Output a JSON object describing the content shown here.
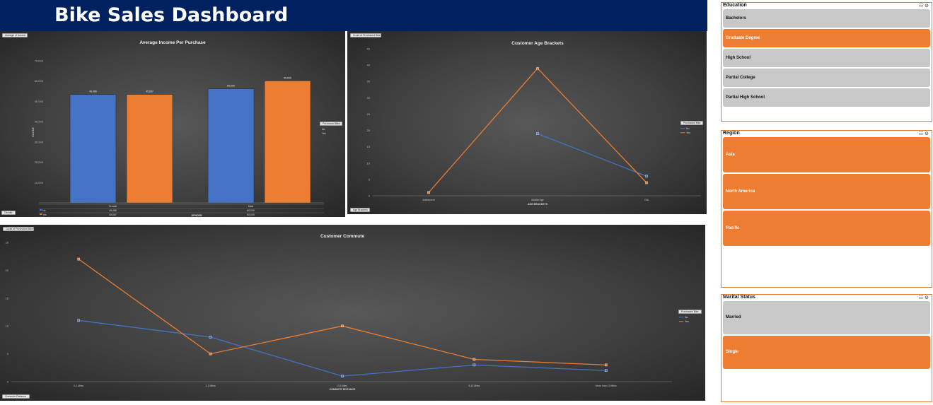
{
  "title": "Bike Sales Dashboard",
  "colors": {
    "no": "#4472c4",
    "yes": "#ed7d31",
    "banner": "#002060"
  },
  "chart1": {
    "filter_pill": "Average of Income",
    "axis_pill": "Gender",
    "legend_pill": "Purchased Bike",
    "legend_items": [
      "No",
      "Yes"
    ],
    "ytitle": "INCOME",
    "table_no_label": "No",
    "table_yes_label": "Yes"
  },
  "chart2": {
    "filter_pill": "Count of Purchased Bike",
    "axis_pill": "Age Brackets",
    "legend_pill": "Purchased Bike",
    "legend_items": [
      "No",
      "Yes"
    ]
  },
  "chart3": {
    "filter_pill": "Count of Purchased Bike",
    "axis_pill": "Commute Distance",
    "legend_pill": "Purchased Bike",
    "legend_items": [
      "No",
      "Yes"
    ],
    "ytitle": "AXIS TITLE"
  },
  "chart_data": [
    {
      "type": "bar",
      "title": "Average Income Per Purchase",
      "xlabel": "GENDER",
      "ylabel": "INCOME",
      "categories": [
        "Female",
        "Male"
      ],
      "series": [
        {
          "name": "No",
          "values": [
            53440,
            56208
          ]
        },
        {
          "name": "Yes",
          "values": [
            53450,
            60124
          ]
        }
      ],
      "ylim": [
        0,
        70000
      ],
      "yticks": [
        "",
        "10,000",
        "20,000",
        "30,000",
        "40,000",
        "50,000",
        "60,000",
        "70,000"
      ],
      "value_labels": {
        "No": [
          "49,466",
          "60,000"
        ],
        "Yes": [
          "45,667",
          "50,000"
        ]
      },
      "table": {
        "No": [
          "49,466",
          "60,000"
        ],
        "Yes": [
          "45,667",
          "50,000"
        ]
      }
    },
    {
      "type": "line",
      "title": "Customer Age Brackets",
      "xlabel": "AGE BRACKETS",
      "categories": [
        "Adolescent",
        "Middle Age",
        "Old"
      ],
      "series": [
        {
          "name": "No",
          "values": [
            null,
            19,
            6
          ]
        },
        {
          "name": "Yes",
          "values": [
            1,
            39,
            4
          ]
        }
      ],
      "ylim": [
        0,
        45
      ],
      "yticks": [
        "0",
        "5",
        "10",
        "15",
        "20",
        "25",
        "30",
        "35",
        "40",
        "45"
      ]
    },
    {
      "type": "line",
      "title": "Customer Commute",
      "xlabel": "COMMUTE DISTANCE",
      "ylabel": "AXIS TITLE",
      "categories": [
        "0-1 Miles",
        "1-2 Miles",
        "2-5 Miles",
        "5-10 Miles",
        "More than 10 Miles"
      ],
      "series": [
        {
          "name": "No",
          "values": [
            11,
            8,
            1,
            3,
            2
          ]
        },
        {
          "name": "Yes",
          "values": [
            22,
            5,
            10,
            4,
            3
          ]
        }
      ],
      "ylim": [
        0,
        25
      ],
      "yticks": [
        "0",
        "5",
        "10",
        "15",
        "20",
        "25"
      ]
    }
  ],
  "slicers": {
    "education": {
      "title": "Education",
      "items": [
        {
          "label": "Bachelors",
          "selected": false
        },
        {
          "label": "Graduate Degree",
          "selected": true
        },
        {
          "label": "High School",
          "selected": false
        },
        {
          "label": "Partial College",
          "selected": false
        },
        {
          "label": "Partial High School",
          "selected": false
        }
      ]
    },
    "region": {
      "title": "Region",
      "items": [
        {
          "label": "Asia",
          "selected": true
        },
        {
          "label": "North America",
          "selected": true
        },
        {
          "label": "Pacific",
          "selected": true
        }
      ]
    },
    "marital": {
      "title": "Marital Status",
      "items": [
        {
          "label": "Married",
          "selected": false
        },
        {
          "label": "Single",
          "selected": true
        }
      ]
    },
    "icons": [
      "multi-select-icon",
      "clear-filter-icon"
    ]
  }
}
